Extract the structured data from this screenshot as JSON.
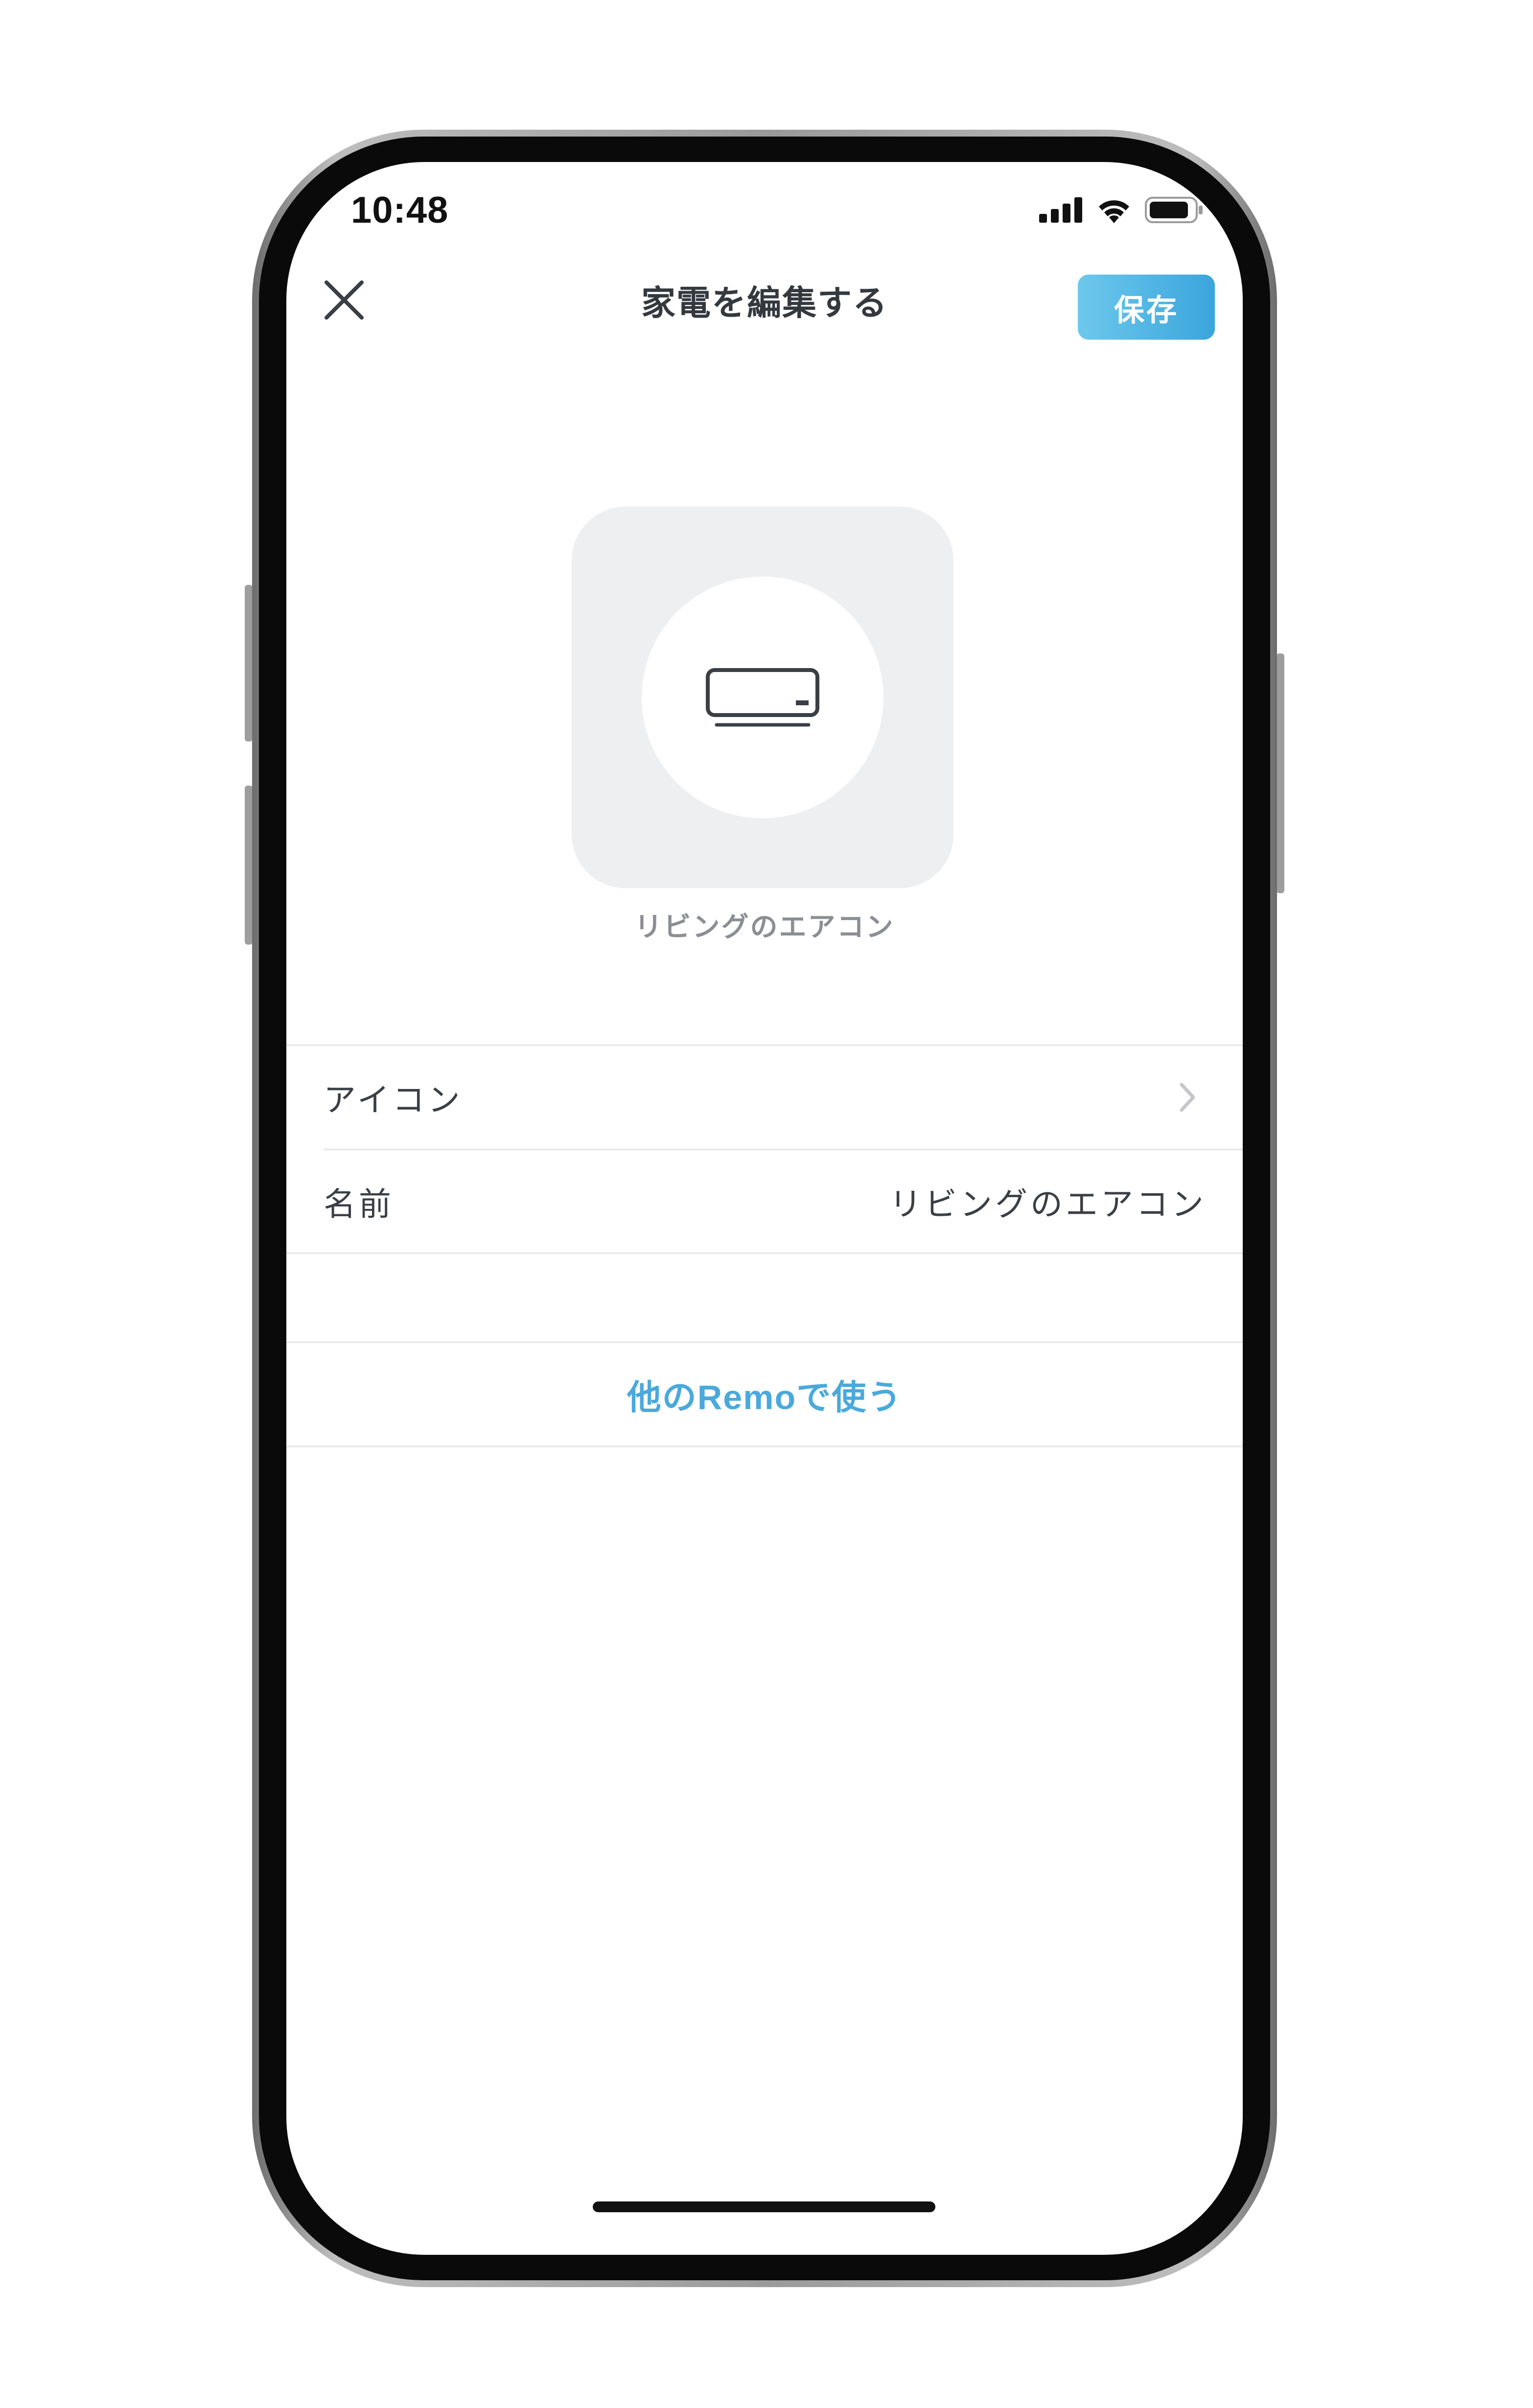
{
  "status_bar": {
    "time": "10:48",
    "icons": [
      "cellular-signal-icon",
      "wifi-icon",
      "battery-icon"
    ]
  },
  "nav": {
    "title": "家電を編集する",
    "close_icon": "close-icon",
    "save_label": "保存"
  },
  "preview": {
    "icon": "air-conditioner-icon",
    "name": "リビングのエアコン"
  },
  "settings": {
    "icon_row": {
      "label": "アイコン",
      "chevron_icon": "chevron-right-icon"
    },
    "name_row": {
      "label": "名前",
      "value": "リビングのエアコン"
    }
  },
  "actions": {
    "use_with_other_remo": "他のRemoで使う"
  },
  "colors": {
    "accent": "#4aa9dc",
    "save_gradient_start": "#6dc8ec",
    "save_gradient_end": "#3aa5dc",
    "tile_background": "#eeeff0",
    "divider": "#e4e5e7",
    "text_primary": "#3a3f45",
    "text_secondary": "#8b8f94"
  }
}
